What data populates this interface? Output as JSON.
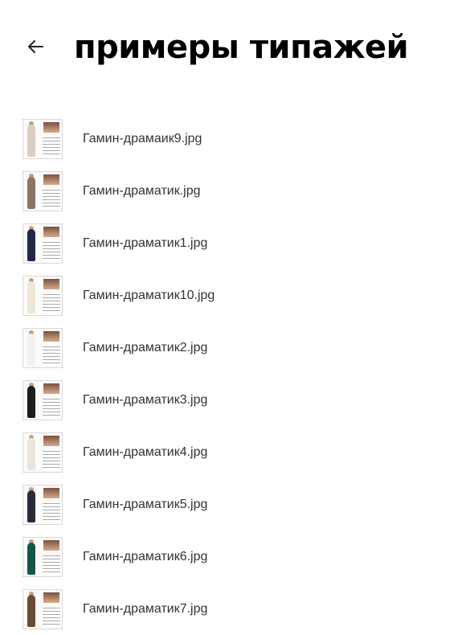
{
  "header": {
    "title": "примеры типажей",
    "back_icon": "arrow-left-icon"
  },
  "files": [
    {
      "name": "Гамин-драмаик9.jpg",
      "dress_color": "#d8cfc1"
    },
    {
      "name": "Гамин-драматик.jpg",
      "dress_color": "#8a7466"
    },
    {
      "name": "Гамин-драматик1.jpg",
      "dress_color": "#23284a"
    },
    {
      "name": "Гамин-драматик10.jpg",
      "dress_color": "#efe8d8"
    },
    {
      "name": "Гамин-драматик2.jpg",
      "dress_color": "#f2f2f0"
    },
    {
      "name": "Гамин-драматик3.jpg",
      "dress_color": "#1d1d1d"
    },
    {
      "name": "Гамин-драматик4.jpg",
      "dress_color": "#ece6da"
    },
    {
      "name": "Гамин-драматик5.jpg",
      "dress_color": "#2a2a3a"
    },
    {
      "name": "Гамин-драматик6.jpg",
      "dress_color": "#14574a"
    },
    {
      "name": "Гамин-драматик7.jpg",
      "dress_color": "#6a4a34"
    }
  ]
}
